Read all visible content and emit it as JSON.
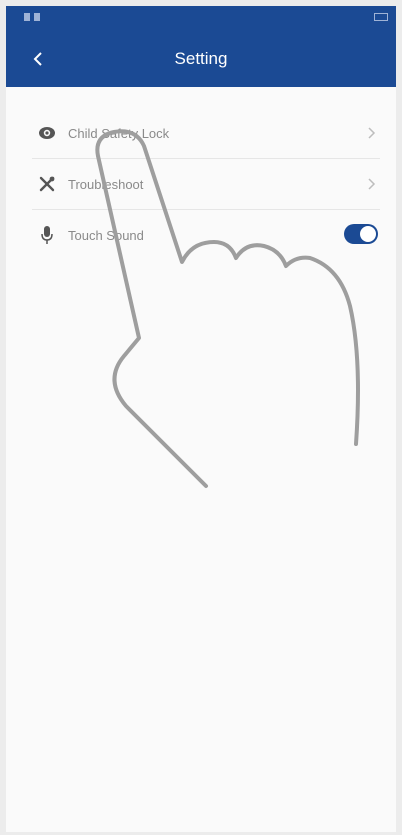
{
  "header": {
    "title": "Setting"
  },
  "settings": {
    "items": [
      {
        "label": "Child Safety Lock",
        "icon": "child-lock-icon",
        "control": "chevron"
      },
      {
        "label": "Troubleshoot",
        "icon": "tools-icon",
        "control": "chevron"
      },
      {
        "label": "Touch Sound",
        "icon": "microphone-icon",
        "control": "toggle",
        "enabled": true
      }
    ]
  },
  "colors": {
    "brand": "#1b4a94",
    "background": "#fafafa",
    "divider": "#e6e6e6",
    "label": "#8a8a8a"
  }
}
